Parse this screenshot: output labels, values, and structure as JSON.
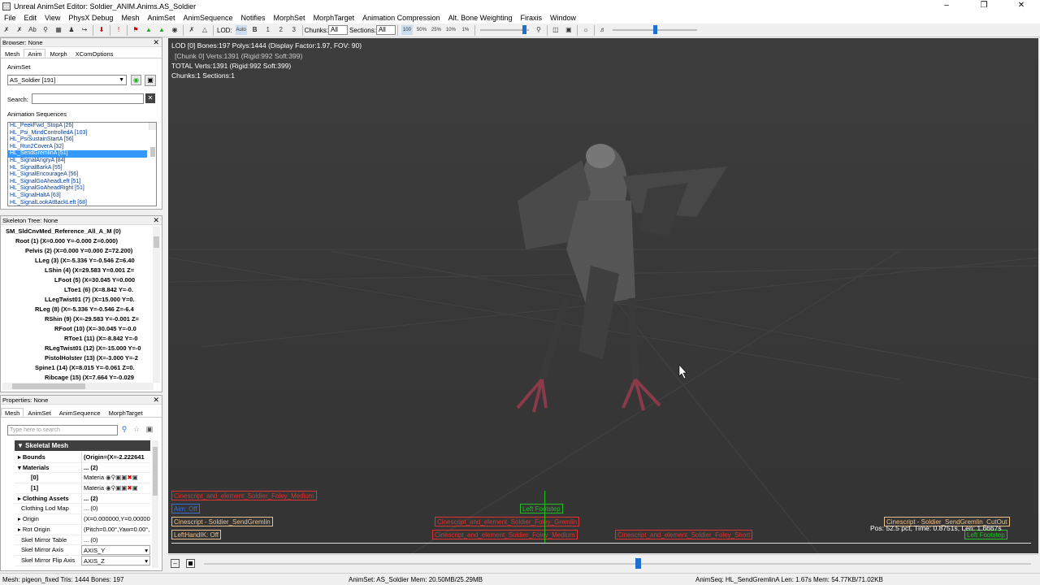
{
  "window": {
    "title": "Unreal AnimSet Editor: Soldier_ANIM.Anims.AS_Soldier"
  },
  "menu": [
    "File",
    "Edit",
    "View",
    "PhysX Debug",
    "Mesh",
    "AnimSet",
    "AnimSequence",
    "Notifies",
    "MorphSet",
    "MorphTarget",
    "Animation Compression",
    "Alt. Bone Weighting",
    "Firaxis",
    "Window"
  ],
  "toolbar": {
    "lod_label": "LOD:",
    "lod_auto": "Auto",
    "lod_base": "B",
    "lod_1": "1",
    "lod_2": "2",
    "lod_3": "3",
    "chunks_label": "Chunks:",
    "chunks_value": "All",
    "sections_label": "Sections:",
    "sections_value": "All",
    "speed_100": "100",
    "speed_50": "50%",
    "speed_25": "25%",
    "speed_10": "10%",
    "speed_1": "1%"
  },
  "browser": {
    "title": "Browser: None",
    "tabs": [
      "Mesh",
      "Anim",
      "Morph",
      "XComOptions"
    ],
    "animset_label": "AnimSet",
    "animset_value": "AS_Soldier [191]",
    "search_label": "Search:",
    "sequences_label": "Animation Sequences",
    "sequences": [
      "HL_PeekFwd_StopA [26]",
      "HL_Psi_MindControlledA [103]",
      "HL_PsiSustainStartA [56]",
      "HL_Run2CoverA [32]",
      "HL_SendGremlinA [51]",
      "HL_SignalAngryA [84]",
      "HL_SignalBarkA [55]",
      "HL_SignalEncourageA [56]",
      "HL_SignalGoAheadLeft [51]",
      "HL_SignalGoAheadRight [51]",
      "HL_SignalHaltA [63]",
      "HL_SignalLookAtBackLeft [68]"
    ],
    "selected_index": 4
  },
  "skeleton": {
    "title": "Skeleton Tree: None",
    "nodes": [
      {
        "label": "SM_SldCnvMed_Reference_All_A_M (0)",
        "depth": 0
      },
      {
        "label": "Root (1) (X=0.000 Y=-0.000 Z=0.000)",
        "depth": 1
      },
      {
        "label": "Pelvis (2) (X=0.000 Y=0.000 Z=72.200)",
        "depth": 2
      },
      {
        "label": "LLeg (3) (X=-5.336 Y=-0.546 Z=6.40",
        "depth": 3
      },
      {
        "label": "LShin (4) (X=29.583 Y=0.001 Z=",
        "depth": 4
      },
      {
        "label": "LFoot (5) (X=30.045 Y=0.000",
        "depth": 5
      },
      {
        "label": "LToe1 (6) (X=8.842 Y=-0.",
        "depth": 6
      },
      {
        "label": "LLegTwist01 (7) (X=15.000 Y=0.",
        "depth": 4
      },
      {
        "label": "RLeg (8) (X=-5.336 Y=-0.546 Z=-6.4",
        "depth": 3
      },
      {
        "label": "RShin (9) (X=-29.583 Y=-0.001 Z=",
        "depth": 4
      },
      {
        "label": "RFoot (10) (X=-30.045 Y=-0.0",
        "depth": 5
      },
      {
        "label": "RToe1 (11) (X=-8.842 Y=-0",
        "depth": 6
      },
      {
        "label": "RLegTwist01 (12) (X=-15.000 Y=-0",
        "depth": 4
      },
      {
        "label": "PistolHolster (13) (X=-3.000 Y=-2",
        "depth": 4
      },
      {
        "label": "Spine1 (14) (X=8.015 Y=-0.061 Z=0.",
        "depth": 3
      },
      {
        "label": "Ribcage (15) (X=7.664 Y=-0.029",
        "depth": 4
      }
    ]
  },
  "properties": {
    "title": "Properties: None",
    "tabs": [
      "Mesh",
      "AnimSet",
      "AnimSequence",
      "MorphTarget"
    ],
    "search_placeholder": "Type here to search",
    "category": "Skeletal Mesh",
    "rows": [
      {
        "k": "Bounds",
        "v": "(Origin=(X=-2.222641",
        "bold": true
      },
      {
        "k": "Materials",
        "v": "... (2)",
        "bold": true
      },
      {
        "k": "[0]",
        "v": "Materia",
        "bold": true
      },
      {
        "k": "[1]",
        "v": "Materia",
        "bold": true
      },
      {
        "k": "Clothing Assets",
        "v": "... (2)",
        "bold": true
      },
      {
        "k": "Clothing Lod Map",
        "v": "... (0)",
        "bold": false
      },
      {
        "k": "Origin",
        "v": "(X=0.000000,Y=0.000000",
        "bold": false
      },
      {
        "k": "Rot Origin",
        "v": "(Pitch=0.00°,Yaw=0.00°,",
        "bold": false
      },
      {
        "k": "Skel Mirror Table",
        "v": "... (0)",
        "bold": false
      },
      {
        "k": "Skel Mirror Axis",
        "v": "AXIS_Y",
        "bold": false
      },
      {
        "k": "Skel Mirror Flip Axis",
        "v": "AXIS_Z",
        "bold": false
      }
    ]
  },
  "viewport": {
    "hud": [
      "LOD [0] Bones:197 Polys:1444 (Display Factor:1.97, FOV: 90)",
      "[Chunk 0] Verts:1391 (Rigid:992 Soft:399)",
      "TOTAL Verts:1391 (Rigid:992 Soft:399)",
      "Chunks:1 Sections:1"
    ],
    "pos_text": "Pos: 52.5 pct, Time: 0.8751s, Len: 1.6667s",
    "notifies": [
      {
        "text": "Cinescript_and_element_Soldier_Foley_Medium",
        "color": "#e03030"
      },
      {
        "text": "Aim: Off",
        "color": "#3a6fd8"
      },
      {
        "text": "Left Footstep",
        "color": "#20c020"
      },
      {
        "text": "Cinescript - Soldier_SendGremlin",
        "color": "#e8c090"
      },
      {
        "text": "Cinescript_and_element_Soldier_Foley_Gremlin",
        "color": "#e03030"
      },
      {
        "text": "Cinescript - Soldier_SendGremlin_CutOut",
        "color": "#e8c090"
      },
      {
        "text": "LeftHandIK: Off",
        "color": "#e8c090"
      },
      {
        "text": "Cinescript_and_element_Soldier_Foley_Medium",
        "color": "#e03030"
      },
      {
        "text": "Cinescript_and_element_Soldier_Foley_Short",
        "color": "#e03030"
      },
      {
        "text": "Left Footstep",
        "color": "#20c020"
      }
    ]
  },
  "timeline": {
    "position": 0.525
  },
  "status": {
    "mesh": "Mesh: pigeon_fixed  Tris: 1444  Bones: 197",
    "animset": "AnimSet: AS_Soldier  Mem: 20.50MB/25.29MB",
    "animseq": "AnimSeq: HL_SendGremlinA  Len: 1.67s  Mem: 54.77KB/71.02KB"
  }
}
